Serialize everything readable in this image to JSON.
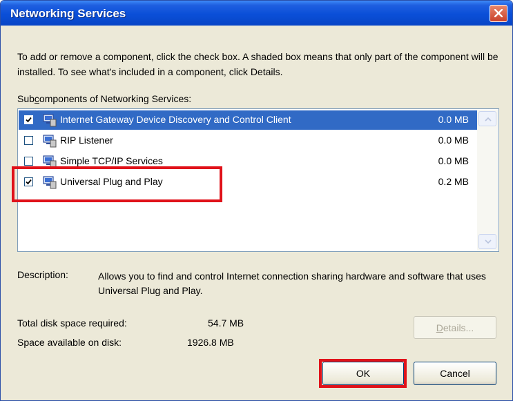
{
  "window": {
    "title": "Networking Services",
    "close_icon": "close-icon"
  },
  "intro_text": "To add or remove a component, click the check box. A shaded box means that only part of the component will be installed. To see what's included in a component, click Details.",
  "subcomponents_label": {
    "prefix": "Sub",
    "accel": "c",
    "suffix": "omponents of Networking Services:"
  },
  "components": [
    {
      "label": "Internet Gateway Device Discovery and Control Client",
      "size": "0.0 MB",
      "checked": true,
      "selected": true
    },
    {
      "label": "RIP Listener",
      "size": "0.0 MB",
      "checked": false,
      "selected": false
    },
    {
      "label": "Simple TCP/IP Services",
      "size": "0.0 MB",
      "checked": false,
      "selected": false
    },
    {
      "label": "Universal Plug and Play",
      "size": "0.2 MB",
      "checked": true,
      "selected": false
    }
  ],
  "description": {
    "label": "Description:",
    "text": "Allows you to find and control Internet connection sharing hardware and software that uses Universal Plug and Play."
  },
  "disk": {
    "required_label": "Total disk space required:",
    "required_value": "54.7 MB",
    "available_label": "Space available on disk:",
    "available_value": "1926.8 MB"
  },
  "buttons": {
    "details": {
      "accel": "D",
      "rest": "etails..."
    },
    "ok": "OK",
    "cancel": "Cancel"
  },
  "highlight_color": "#e0121a",
  "selection_color": "#316ac5",
  "titlebar_color": "#0a4fd8"
}
